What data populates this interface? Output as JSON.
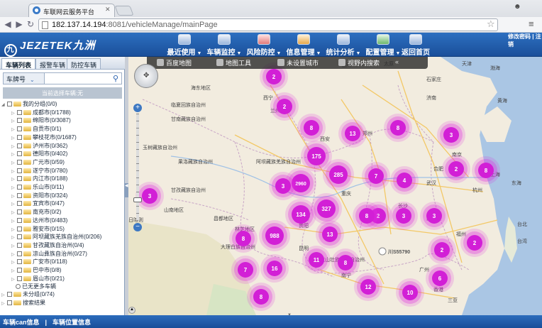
{
  "browser": {
    "tab_title": "车联网云服务平台",
    "url_host": "182.137.14.194",
    "url_rest": ":8081/vehicleManage/mainPage"
  },
  "header": {
    "brand": "JEZETEK九洲",
    "menu": [
      {
        "label": "最近使用",
        "dropdown": true,
        "icon": "recent-icon"
      },
      {
        "label": "车辆监控",
        "dropdown": true,
        "icon": "monitor-icon"
      },
      {
        "label": "风险防控",
        "dropdown": true,
        "icon": "risk-icon"
      },
      {
        "label": "信息管理",
        "dropdown": true,
        "icon": "info-icon"
      },
      {
        "label": "统计分析",
        "dropdown": true,
        "icon": "stats-icon"
      },
      {
        "label": "配置管理",
        "dropdown": true,
        "icon": "config-icon"
      },
      {
        "label": "返回首页",
        "dropdown": false,
        "icon": "home-icon"
      }
    ],
    "top_links": [
      "修改密码",
      "|",
      "注销"
    ]
  },
  "left_panel": {
    "tabs": [
      {
        "label": "车辆列表",
        "active": true
      },
      {
        "label": "报警车辆",
        "active": false
      },
      {
        "label": "防控车辆",
        "active": false
      }
    ],
    "filter_select": "车牌号",
    "filter_placeholder": "",
    "current_line": "当前选择车辆:无",
    "tree": [
      {
        "label": "我的分组(0/0)",
        "level": 0,
        "expanded": true
      },
      {
        "label": "成都市(0/1788)",
        "level": 1
      },
      {
        "label": "绵阳市(0/3087)",
        "level": 1
      },
      {
        "label": "自贡市(0/1)",
        "level": 1
      },
      {
        "label": "攀枝花市(0/1687)",
        "level": 1
      },
      {
        "label": "泸州市(0/362)",
        "level": 1
      },
      {
        "label": "德阳市(0/402)",
        "level": 1
      },
      {
        "label": "广元市(0/59)",
        "level": 1
      },
      {
        "label": "遂宁市(0/780)",
        "level": 1
      },
      {
        "label": "内江市(0/188)",
        "level": 1
      },
      {
        "label": "乐山市(0/11)",
        "level": 1
      },
      {
        "label": "资阳市(0/324)",
        "level": 1
      },
      {
        "label": "宜宾市(0/47)",
        "level": 1
      },
      {
        "label": "南充市(0/2)",
        "level": 1
      },
      {
        "label": "达州市(0/483)",
        "level": 1
      },
      {
        "label": "雅安市(0/15)",
        "level": 1
      },
      {
        "label": "阿坝藏族羌族自治州(0/206)",
        "level": 1
      },
      {
        "label": "甘孜藏族自治州(0/4)",
        "level": 1
      },
      {
        "label": "凉山彝族自治州(0/27)",
        "level": 1
      },
      {
        "label": "广安市(0/118)",
        "level": 1
      },
      {
        "label": "巴中市(0/8)",
        "level": 1
      },
      {
        "label": "眉山市(0/21)",
        "level": 1
      },
      {
        "label": "已无更多车辆",
        "level": 2
      },
      {
        "label": "未分组(0/74)",
        "level": 0
      },
      {
        "label": "搜索结果",
        "level": 0
      }
    ]
  },
  "map": {
    "toolbar": [
      {
        "label": "百度地图",
        "icon": "map-icon"
      },
      {
        "label": "地图工具",
        "icon": "tools-icon"
      },
      {
        "label": "未设置城市",
        "icon": "location-icon"
      },
      {
        "label": "视野内搜索",
        "icon": "search-icon"
      }
    ],
    "clusters": [
      "2",
      "2",
      "8",
      "13",
      "8",
      "3",
      "175",
      "2",
      "8",
      "2960",
      "285",
      "7",
      "4",
      "3",
      "2",
      "134",
      "327",
      "8",
      "3",
      "3",
      "8",
      "988",
      "13",
      "2",
      "7",
      "16",
      "11",
      "8",
      "12",
      "10",
      "6",
      "2",
      "8",
      "3"
    ],
    "labels": [
      "西宁",
      "兰州",
      "银川",
      "太原",
      "石家庄",
      "济南",
      "天津",
      "渤海",
      "海东地区",
      "临夏回族自治州",
      "甘南藏族自治州",
      "郑州",
      "西安",
      "南京",
      "合肥",
      "上海",
      "杭州",
      "武汉",
      "长沙",
      "南昌",
      "福州",
      "重庆",
      "贵阳",
      "昆明",
      "南宁",
      "广州",
      "香港",
      "台湾",
      "玉树藏族自治州",
      "果洛藏族自治州",
      "阿坝藏族羌族自治州",
      "甘孜藏族自治州",
      "山南地区",
      "林芝地区",
      "昌都地区",
      "日喀则",
      "大理白族自治州",
      "文山壮族苗族自治州",
      "黄海",
      "东海",
      "台北",
      "川S55790",
      "三亚"
    ],
    "tooltip": "川S55790"
  },
  "footer": {
    "items": [
      "车辆can信息",
      "|",
      "车辆位置信息"
    ]
  }
}
